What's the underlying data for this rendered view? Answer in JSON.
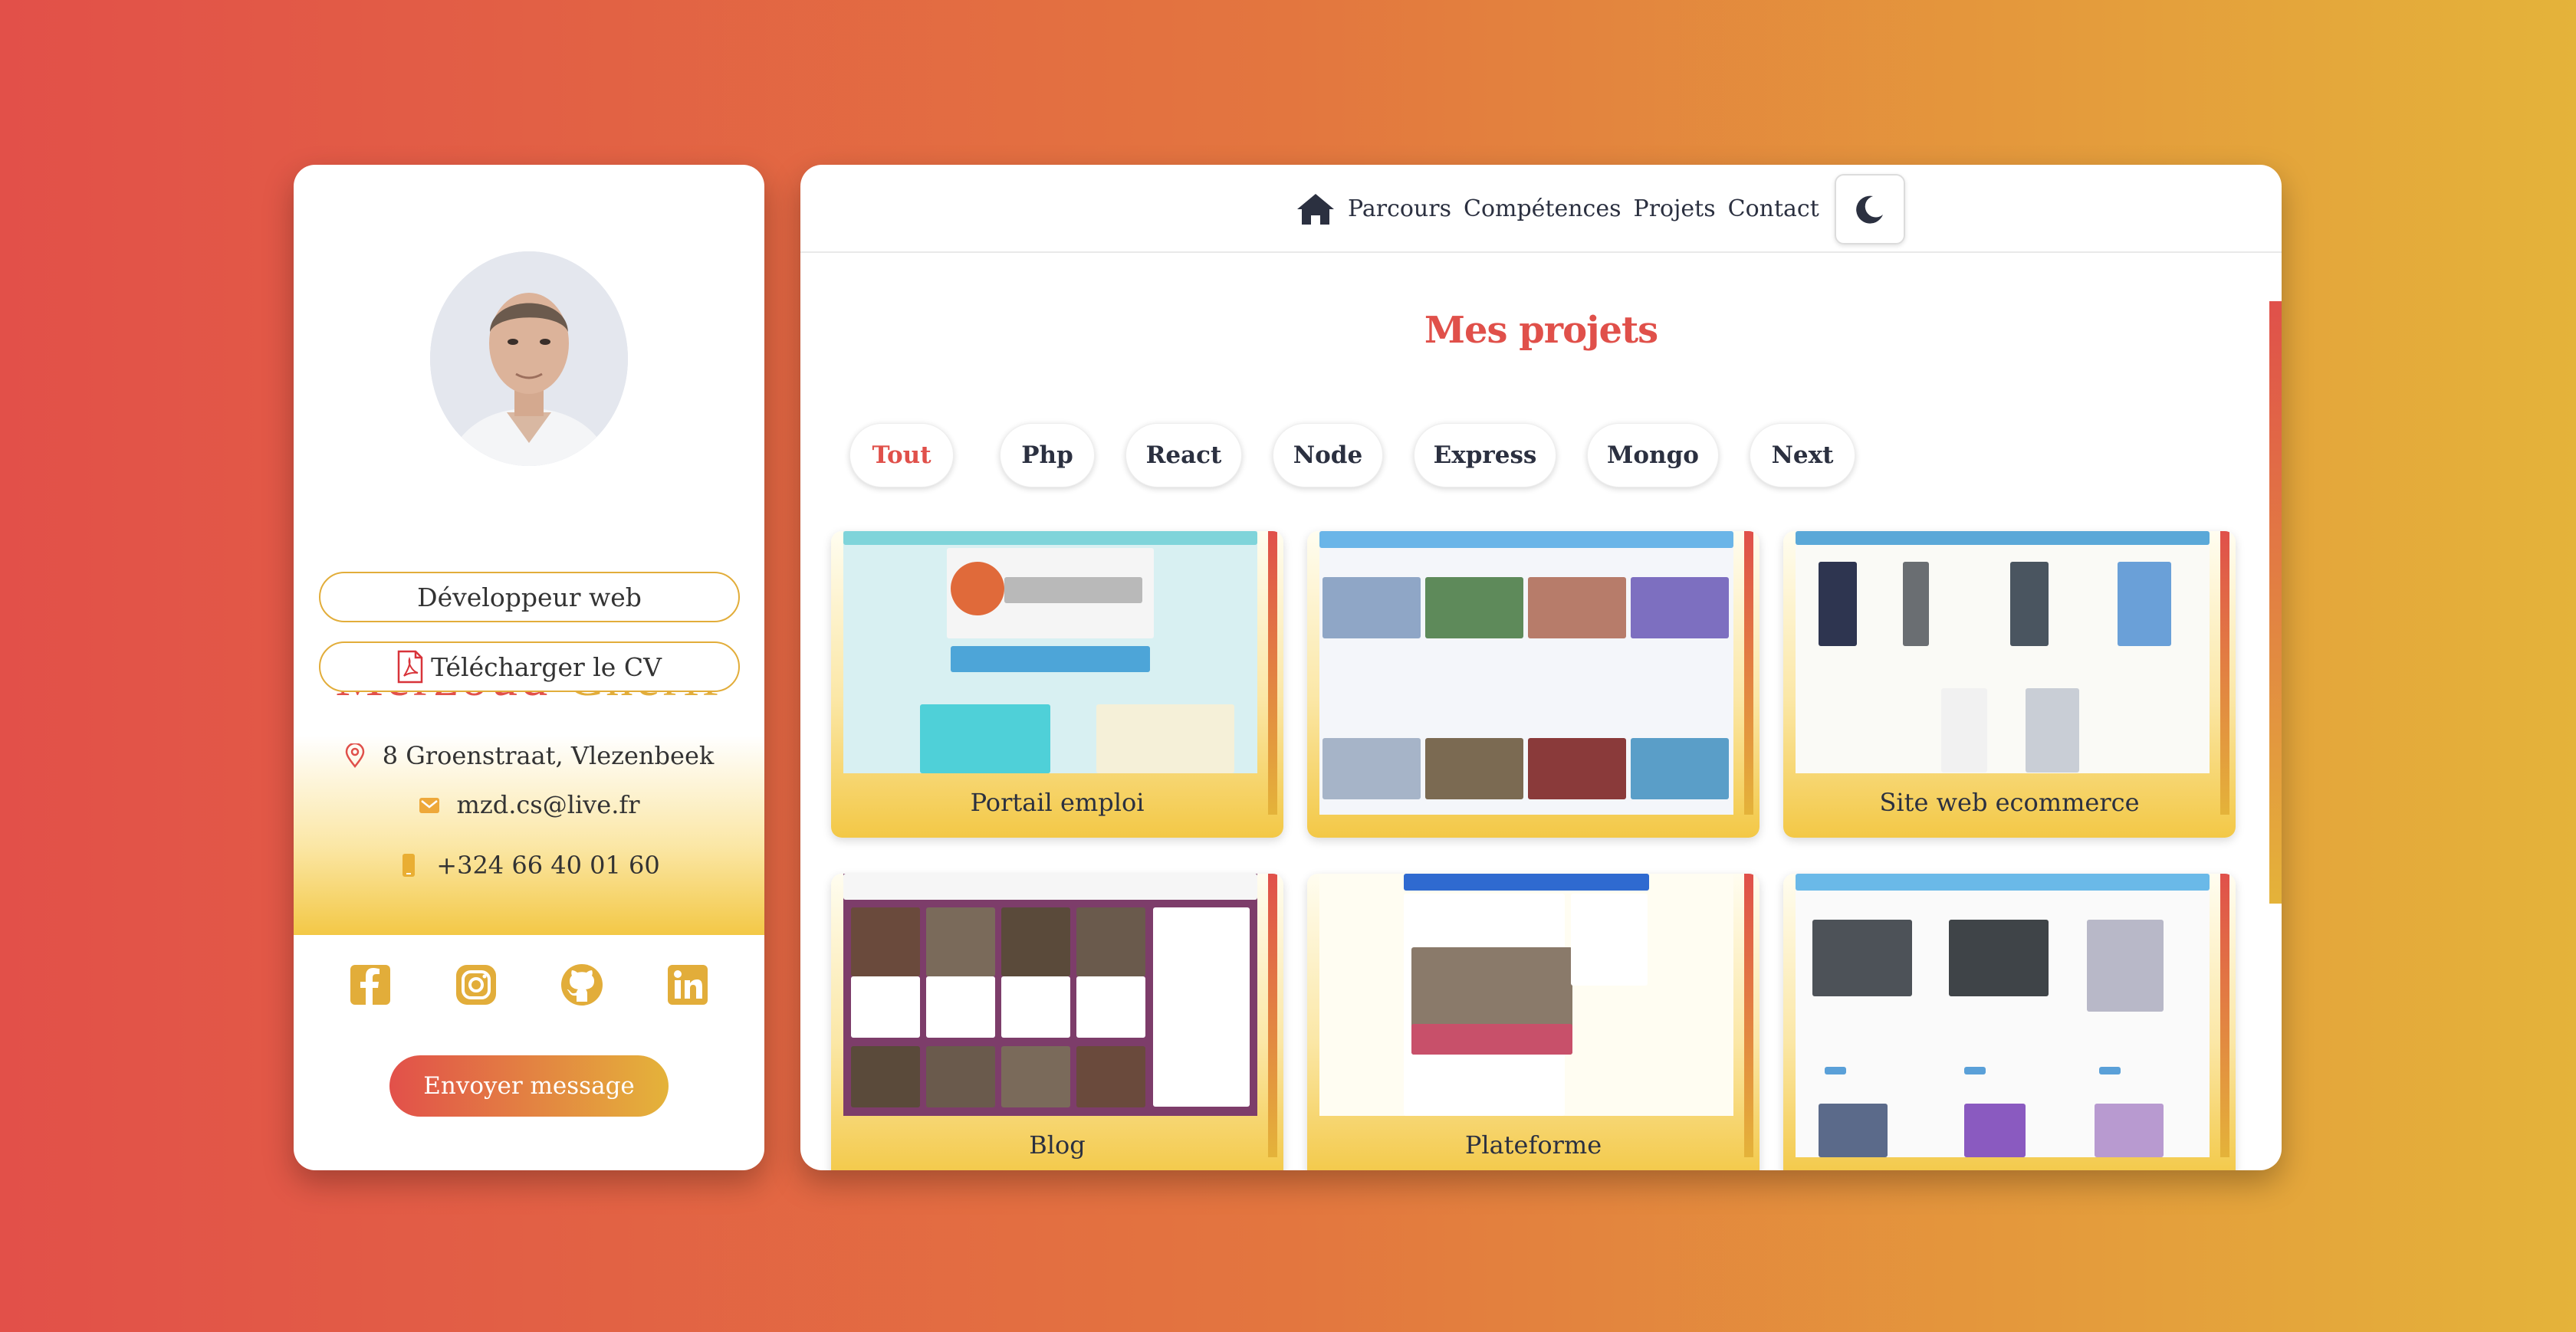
{
  "profile": {
    "first_name": "Merzoud",
    "last_name": "Cherif",
    "role": "Développeur web",
    "download_cv": "Télécharger le CV",
    "address": "8 Groenstraat, Vlezenbeek",
    "email": "mzd.cs@live.fr",
    "phone": "+324 66 40 01 60",
    "send_message": "Envoyer message",
    "socials": [
      "facebook-icon",
      "instagram-icon",
      "github-icon",
      "linkedin-icon"
    ]
  },
  "nav": {
    "items": [
      "Parcours",
      "Compétences",
      "Projets",
      "Contact"
    ]
  },
  "projects": {
    "title": "Mes projets",
    "filters": [
      "Tout",
      "Php",
      "React",
      "Node",
      "Express",
      "Mongo",
      "Next"
    ],
    "active_filter": "Tout",
    "cards": [
      {
        "label": "Portail emploi"
      },
      {
        "label": ""
      },
      {
        "label": "Site web ecommerce"
      },
      {
        "label": "Blog"
      },
      {
        "label": "Plateforme"
      },
      {
        "label": ""
      }
    ]
  },
  "colors": {
    "accent_red": "#e0504a",
    "accent_gold": "#e4b33a",
    "text_dark": "#2b3040"
  }
}
